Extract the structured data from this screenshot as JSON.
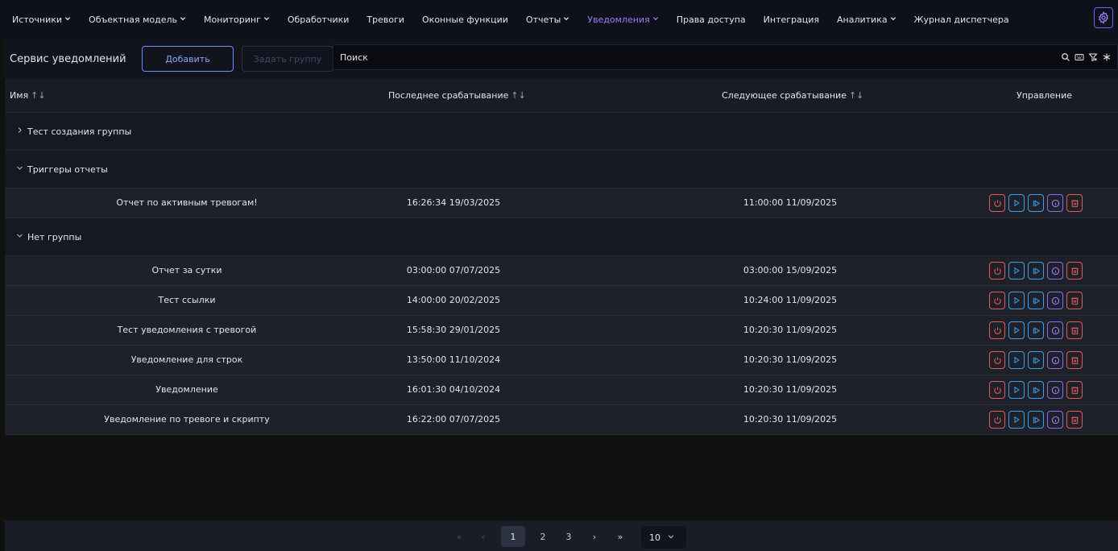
{
  "nav": {
    "items": [
      {
        "label": "Источники",
        "dropdown": true,
        "active": false
      },
      {
        "label": "Объектная модель",
        "dropdown": true,
        "active": false
      },
      {
        "label": "Мониторинг",
        "dropdown": true,
        "active": false
      },
      {
        "label": "Обработчики",
        "dropdown": false,
        "active": false
      },
      {
        "label": "Тревоги",
        "dropdown": false,
        "active": false
      },
      {
        "label": "Оконные функции",
        "dropdown": false,
        "active": false
      },
      {
        "label": "Отчеты",
        "dropdown": true,
        "active": false
      },
      {
        "label": "Уведомления",
        "dropdown": true,
        "active": true
      },
      {
        "label": "Права доступа",
        "dropdown": false,
        "active": false
      },
      {
        "label": "Интеграция",
        "dropdown": false,
        "active": false
      },
      {
        "label": "Аналитика",
        "dropdown": true,
        "active": false
      },
      {
        "label": "Журнал диспетчера",
        "dropdown": false,
        "active": false
      }
    ],
    "settings_icon": "gear-icon"
  },
  "toolbar": {
    "title": "Сервис уведомлений",
    "add_label": "Добавить",
    "group_label": "Задать группу",
    "search_placeholder": "Поиск",
    "search_icons": [
      "search-icon",
      "keyboard-icon",
      "filter-off-icon",
      "asterisk-icon"
    ]
  },
  "table": {
    "columns": {
      "name": "Имя",
      "last": "Последнее срабатывание",
      "next": "Следующее срабатывание",
      "actions": "Управление"
    },
    "groups": [
      {
        "name": "Тест создания группы",
        "expanded": false,
        "rows": []
      },
      {
        "name": "Триггеры отчеты",
        "expanded": true,
        "rows": [
          {
            "name": "Отчет по активным тревогам!",
            "last": "16:26:34 19/03/2025",
            "next": "11:00:00 11/09/2025"
          }
        ]
      },
      {
        "name": "Нет группы",
        "expanded": true,
        "rows": [
          {
            "name": "Отчет за сутки",
            "last": "03:00:00 07/07/2025",
            "next": "03:00:00 15/09/2025"
          },
          {
            "name": "Тест ссылки",
            "last": "14:00:00 20/02/2025",
            "next": "10:24:00 11/09/2025"
          },
          {
            "name": "Тест уведомления с тревогой",
            "last": "15:58:30 29/01/2025",
            "next": "10:20:30 11/09/2025"
          },
          {
            "name": "Уведомление для строк",
            "last": "13:50:00 11/10/2024",
            "next": "10:20:30 11/09/2025"
          },
          {
            "name": "Уведомление",
            "last": "16:01:30 04/10/2024",
            "next": "10:20:30 11/09/2025"
          },
          {
            "name": "Уведомление по тревоге и скрипту",
            "last": "16:22:00 07/07/2025",
            "next": "10:20:30 11/09/2025"
          }
        ]
      }
    ],
    "row_action_icons": [
      "power-icon",
      "play-icon",
      "play-outline-icon",
      "info-icon",
      "trash-icon"
    ]
  },
  "pagination": {
    "first": "«",
    "prev": "‹",
    "pages": [
      "1",
      "2",
      "3"
    ],
    "current": "1",
    "next": "›",
    "last": "»",
    "per_page": "10"
  },
  "colors": {
    "accent": "#9b7cf6",
    "danger": "#e35a5a",
    "info": "#3aa0e8"
  }
}
